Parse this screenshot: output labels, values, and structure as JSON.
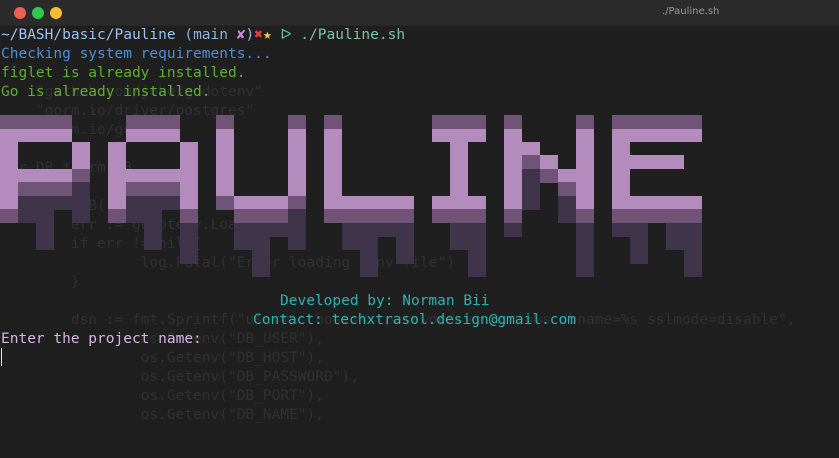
{
  "window": {
    "title": "./Pauline.sh",
    "controls": [
      "close",
      "minimize",
      "maximize"
    ]
  },
  "prompt": {
    "path": "~/BASH/basic/Pauline",
    "branch_open": "(main ",
    "status_mark": "✘",
    "close_paren": ")",
    "error_mark": "✖",
    "star_mark": "★",
    "arrow": "ᐅ",
    "command": "./Pauline.sh"
  },
  "output": {
    "checking": "Checking system requirements...",
    "figlet": "figlet is already installed.",
    "go": "Go is already installed.",
    "banner_text": "PAULINE",
    "developer": "Developed by: Norman Bii",
    "contact": "Contact: techxtrasol.design@gmail.com",
    "enter_project": "Enter the project name:"
  },
  "background_code": [
    "    \"github.com/joho/godotenv\"",
    "    \"gorm.io/driver/postgres\"",
    "    \"gorm.io/gorm\"",
    "",
    "var DB *gorm.DB",
    "",
    "func InitDB() {",
    "        err := godotenv.Load()",
    "        if err != nil {",
    "                log.Fatal(\"Error loading .env file\")",
    "        }",
    "",
    "        dsn := fmt.Sprintf(\"user=%s host=%s password=%s port=%s dbname=%s sslmode=disable\",",
    "                os.Getenv(\"DB_USER\"),",
    "                os.Getenv(\"DB_HOST\"),",
    "                os.Getenv(\"DB_PASSWORD\"),",
    "                os.Getenv(\"DB_PORT\"),",
    "                os.Getenv(\"DB_NAME\"),"
  ],
  "colors": {
    "background": "#1f1f1f",
    "banner_light": "#b48bbd",
    "banner_mid": "#6f5478",
    "banner_dark": "#40344a"
  }
}
